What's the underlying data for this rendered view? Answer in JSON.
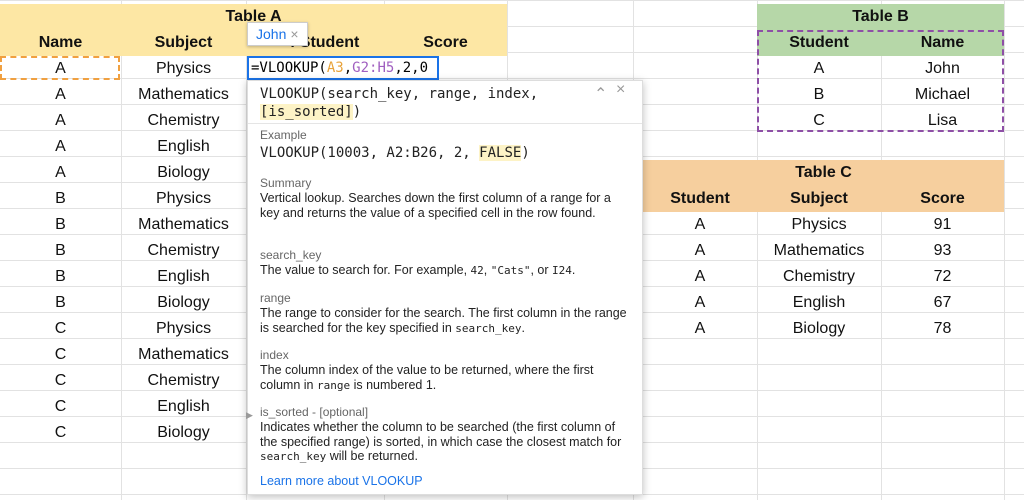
{
  "table_a": {
    "title": "Table A",
    "headers": [
      "Name",
      "Subject",
      "f Student",
      "Score"
    ],
    "rows": [
      [
        "A",
        "Physics"
      ],
      [
        "A",
        "Mathematics"
      ],
      [
        "A",
        "Chemistry"
      ],
      [
        "A",
        "English"
      ],
      [
        "A",
        "Biology"
      ],
      [
        "B",
        "Physics"
      ],
      [
        "B",
        "Mathematics"
      ],
      [
        "B",
        "Chemistry"
      ],
      [
        "B",
        "English"
      ],
      [
        "B",
        "Biology"
      ],
      [
        "C",
        "Physics"
      ],
      [
        "C",
        "Mathematics"
      ],
      [
        "C",
        "Chemistry"
      ],
      [
        "C",
        "English"
      ],
      [
        "C",
        "Biology"
      ]
    ]
  },
  "table_b": {
    "title": "Table B",
    "headers": [
      "Student",
      "Name"
    ],
    "rows": [
      [
        "A",
        "John"
      ],
      [
        "B",
        "Michael"
      ],
      [
        "C",
        "Lisa"
      ]
    ]
  },
  "table_c": {
    "title": "Table C",
    "headers": [
      "Student",
      "Subject",
      "Score"
    ],
    "rows": [
      [
        "A",
        "Physics",
        "91"
      ],
      [
        "A",
        "Mathematics",
        "93"
      ],
      [
        "A",
        "Chemistry",
        "72"
      ],
      [
        "A",
        "English",
        "67"
      ],
      [
        "A",
        "Biology",
        "78"
      ]
    ]
  },
  "formula": {
    "prefix": "=VLOOKUP(",
    "arg1": "A3",
    "sep1": ",",
    "arg2": "G2:H5",
    "rest": ",2,0"
  },
  "value_tip": {
    "value": "John",
    "close": "×"
  },
  "help": {
    "signature_line1": "VLOOKUP(search_key, range, index,",
    "signature_line2": "[is_sorted]",
    "signature_end": ")",
    "collapse": "⌃",
    "close": "×",
    "example_label": "Example",
    "example_code": "VLOOKUP(10003, A2:B26, 2, ",
    "example_hl": "FALSE",
    "example_end": ")",
    "summary_label": "Summary",
    "summary_text": "Vertical lookup. Searches down the first column of a range for a key and returns the value of a specified cell in the row found.",
    "search_key_label": "search_key",
    "search_key_text1": "The value to search for. For example, ",
    "search_key_code1": "42",
    "search_key_text2": ", ",
    "search_key_code2": "\"Cats\"",
    "search_key_text3": ", or ",
    "search_key_code3": "I24",
    "search_key_text4": ".",
    "range_label": "range",
    "range_text": "The range to consider for the search. The first column in the range is searched for the key specified in ",
    "range_code": "search_key",
    "range_end": ".",
    "index_label": "index",
    "index_text1": "The column index of the value to be returned, where the first column in ",
    "index_code": "range",
    "index_text2": " is numbered 1.",
    "is_sorted_label": "is_sorted - [optional]",
    "is_sorted_text": "Indicates whether the column to be searched (the first column of the specified range) is sorted, in which case the closest match for ",
    "is_sorted_code": "search_key",
    "is_sorted_end": " will be returned.",
    "learn_more": "Learn more about VLOOKUP"
  },
  "colors": {
    "table_a_header": "#fde7a4",
    "table_b_header": "#b6d7a8",
    "table_c_header": "#f6cf9e",
    "accent_blue": "#1a73e8"
  }
}
